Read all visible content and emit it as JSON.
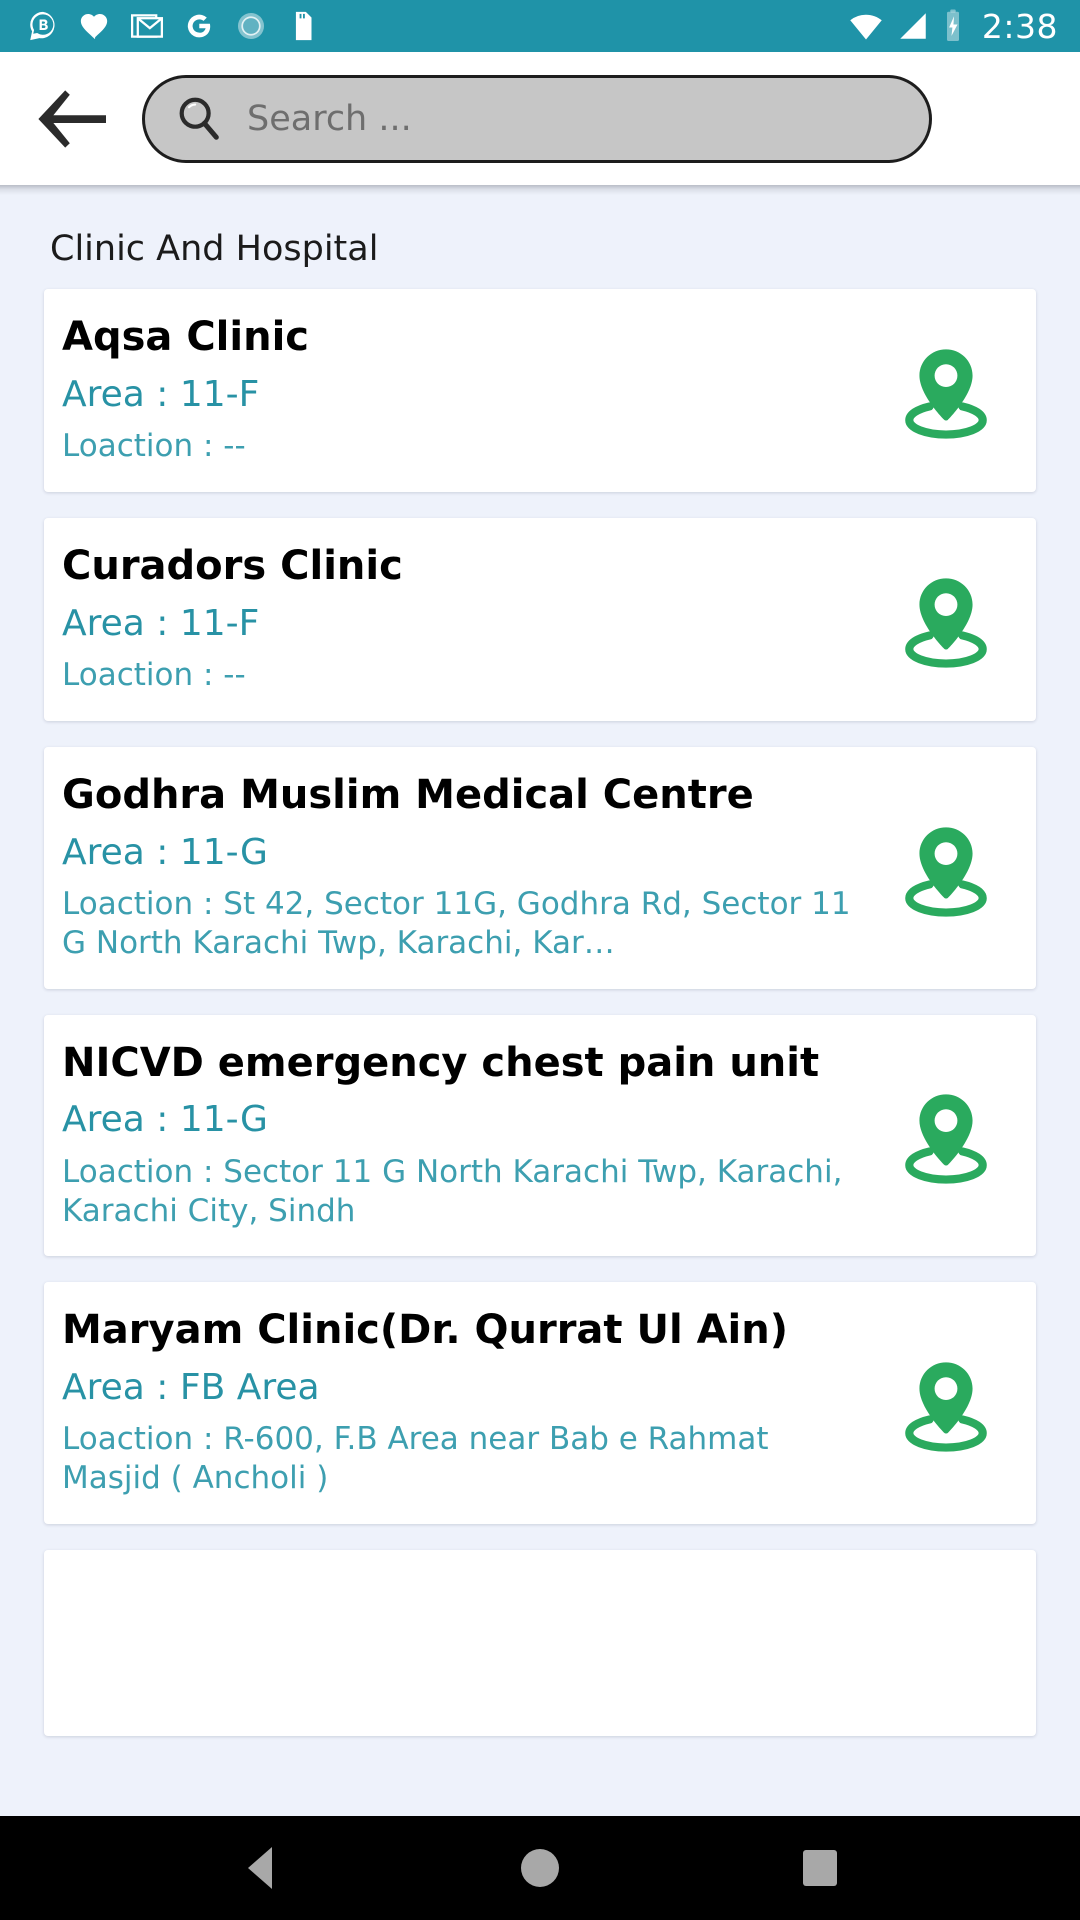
{
  "status_bar": {
    "background_color": "#1f93a8",
    "time": "2:38",
    "left_icons": [
      "bolt-chat-b-icon",
      "heart-icon",
      "gmail-icon",
      "google-g-icon",
      "sync-circle-icon",
      "sd-card-icon"
    ],
    "right_icons": [
      "wifi-icon",
      "cellular-signal-icon",
      "battery-charging-icon"
    ]
  },
  "header": {
    "back_label": "back-arrow",
    "search": {
      "placeholder": "Search ...",
      "value": ""
    }
  },
  "main": {
    "section_title": "Clinic And Hospital",
    "accent_color": "#2892a5",
    "pin_color": "#2aaa5e",
    "items": [
      {
        "name": "Aqsa Clinic",
        "area": "Area : 11-F",
        "location": "Loaction : --"
      },
      {
        "name": "Curadors Clinic",
        "area": "Area : 11-F",
        "location": "Loaction : --"
      },
      {
        "name": "Godhra Muslim Medical Centre",
        "area": "Area : 11-G",
        "location": "Loaction : St 42, Sector 11G, Godhra Rd, Sector 11 G North Karachi Twp, Karachi, Kar…"
      },
      {
        "name": "NICVD emergency chest pain unit",
        "area": "Area : 11-G",
        "location": "Loaction : Sector 11 G North Karachi Twp, Karachi, Karachi City, Sindh"
      },
      {
        "name": "Maryam Clinic(Dr. Qurrat Ul Ain)",
        "area": "Area : FB Area",
        "location": "Loaction :  R-600, F.B Area near Bab e Rahmat Masjid ( Ancholi )"
      }
    ]
  },
  "navbar": {
    "back": "nav-back-button",
    "home": "nav-home-button",
    "recents": "nav-recents-button"
  }
}
